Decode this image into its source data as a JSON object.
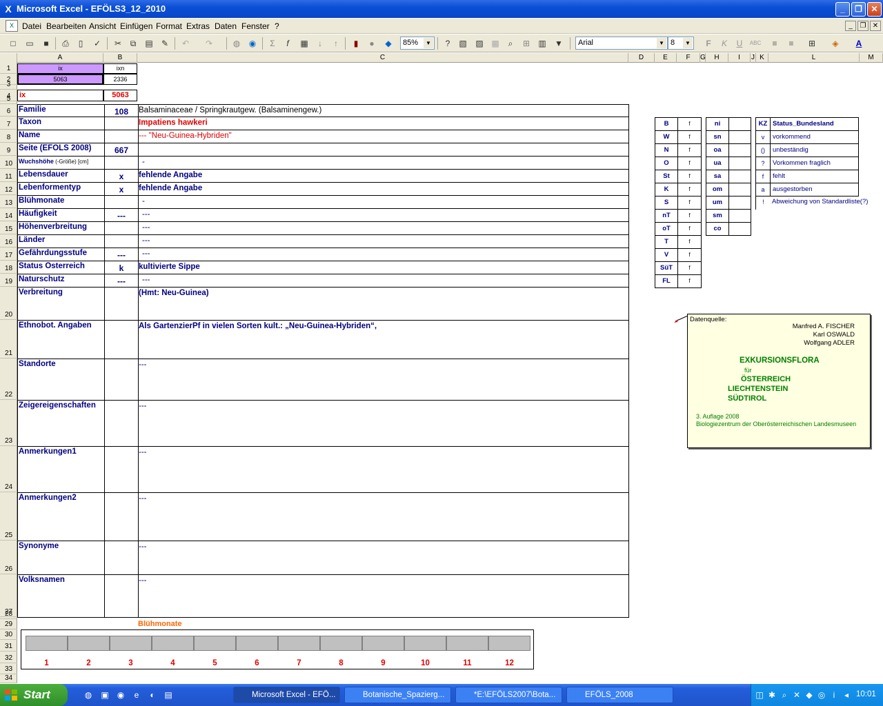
{
  "window": {
    "title": "Microsoft Excel - EFÖLS3_12_2010",
    "min": "_",
    "max": "❐",
    "close": "✕"
  },
  "menu": [
    "Datei",
    "Bearbeiten",
    "Ansicht",
    "Einfügen",
    "Format",
    "Extras",
    "Daten",
    "Fenster",
    "?"
  ],
  "toolbar": {
    "zoom": "85%",
    "font": "Arial",
    "size": "8",
    "bold": "F",
    "italic": "K",
    "underline": "U"
  },
  "columns": [
    "A",
    "B",
    "C",
    "D",
    "E",
    "F",
    "G",
    "H",
    "I",
    "J",
    "K",
    "L",
    "M"
  ],
  "rows": [
    "1",
    "2",
    "3",
    "4",
    "5",
    "6",
    "7",
    "8",
    "9",
    "10",
    "11",
    "12",
    "13",
    "14",
    "15",
    "16",
    "17",
    "18",
    "19",
    "20",
    "21",
    "22",
    "23",
    "24",
    "25",
    "26",
    "27",
    "28",
    "29",
    "30",
    "31",
    "32",
    "33",
    "34"
  ],
  "header": {
    "a1": "ix",
    "b1": "ixn",
    "a2": "5063",
    "b2": "2336",
    "a4": "ix",
    "b4": "5063"
  },
  "fields": [
    {
      "label": "Familie",
      "b": "108",
      "c": "Balsaminaceae  /  Springkrautgew. (Balsaminengew.)"
    },
    {
      "label": "Taxon",
      "b": "",
      "c": "Impatiens hawkeri"
    },
    {
      "label": "Name",
      "b": "",
      "c": "--- \"Neu-Guinea-Hybriden\""
    },
    {
      "label": "Seite (EFÖLS 2008)",
      "b": "667",
      "c": ""
    },
    {
      "label": "Wuchshöhe",
      "label_small": " (-Größe) [cm]",
      "b": "",
      "c": "-"
    },
    {
      "label": "Lebensdauer",
      "b": "x",
      "c": "fehlende Angabe"
    },
    {
      "label": "Lebenformentyp",
      "b": "x",
      "c": "fehlende Angabe"
    },
    {
      "label": "Blühmonate",
      "b": "",
      "c": "-"
    },
    {
      "label": "Häufigkeit",
      "b": "---",
      "c": "---"
    },
    {
      "label": "Höhenverbreitung",
      "b": "",
      "c": "---"
    },
    {
      "label": "Länder",
      "b": "",
      "c": "---"
    },
    {
      "label": "Gefährdungsstufe",
      "b": "---",
      "c": "---"
    },
    {
      "label": "Status Österreich",
      "b": "k",
      "c": "kultivierte Sippe"
    },
    {
      "label": "Naturschutz",
      "b": "---",
      "c": "---"
    },
    {
      "label": "Verbreitung",
      "b": "",
      "c": "(Hmt: Neu-Guinea)"
    },
    {
      "label": "Ethnobot. Angaben",
      "b": "",
      "c": "Als GartenzierPf  in vielen Sorten kult.: „Neu-Guinea-Hybriden“,"
    },
    {
      "label": "Standorte",
      "b": "",
      "c": "---"
    },
    {
      "label": "Zeigereigenschaften",
      "b": "",
      "c": "---"
    },
    {
      "label": "Anmerkungen1",
      "b": "",
      "c": "---"
    },
    {
      "label": "Anmerkungen2",
      "b": "",
      "c": "---"
    },
    {
      "label": "Synonyme",
      "b": "",
      "c": "---"
    },
    {
      "label": "Volksnamen",
      "b": "",
      "c": "---"
    }
  ],
  "regions": [
    [
      "B",
      "f"
    ],
    [
      "W",
      "f"
    ],
    [
      "N",
      "f"
    ],
    [
      "O",
      "f"
    ],
    [
      "St",
      "f"
    ],
    [
      "K",
      "f"
    ],
    [
      "S",
      "f"
    ],
    [
      "nT",
      "f"
    ],
    [
      "oT",
      "f"
    ],
    [
      "T",
      "f"
    ],
    [
      "V",
      "f"
    ],
    [
      "SüT",
      "f"
    ],
    [
      "FL",
      "f"
    ]
  ],
  "zones": [
    "ni",
    "sn",
    "oa",
    "ua",
    "sa",
    "om",
    "um",
    "sm",
    "co"
  ],
  "legend": {
    "kz": "KZ",
    "title": "Status_Bundesland",
    "items": [
      [
        "v",
        "vorkommend"
      ],
      [
        "()",
        "unbeständig"
      ],
      [
        "?",
        "Vorkommen fraglich"
      ],
      [
        "f",
        "fehlt"
      ],
      [
        "a",
        "ausgestorben"
      ],
      [
        "!",
        "Abweichung von Standardliste(?)"
      ]
    ]
  },
  "note": {
    "src": "Datenquelle:",
    "a1": "Manfred A. FISCHER",
    "a2": "Karl OSWALD",
    "a3": "Wolfgang ADLER",
    "t1": "EXKURSIONSFLORA",
    "t2": "für",
    "t3": "ÖSTERREICH",
    "t4": "LIECHTENSTEIN",
    "t5": "SÜDTIROL",
    "ed": "3. Auflage 2008",
    "pub": "Biologiezentrum der Oberösterreichischen Landesmuseen"
  },
  "bluehmonate": {
    "title": "Blühmonate",
    "months": [
      "1",
      "2",
      "3",
      "4",
      "5",
      "6",
      "7",
      "8",
      "9",
      "10",
      "11",
      "12"
    ]
  },
  "taskbar": {
    "start": "Start",
    "tasks": [
      "Microsoft Excel - EFÖ...",
      "Botanische_Spazierg...",
      "*E:\\EFÖLS2007\\Bota...",
      "EFÖLS_2008"
    ],
    "clock": "10:01"
  },
  "colors": {
    "titlebar": "#0a4fd6",
    "label": "#000080",
    "red": "#e00000",
    "note": "#ffffe1",
    "start": "#2f8f2a",
    "highlight": "#cc99ff"
  }
}
